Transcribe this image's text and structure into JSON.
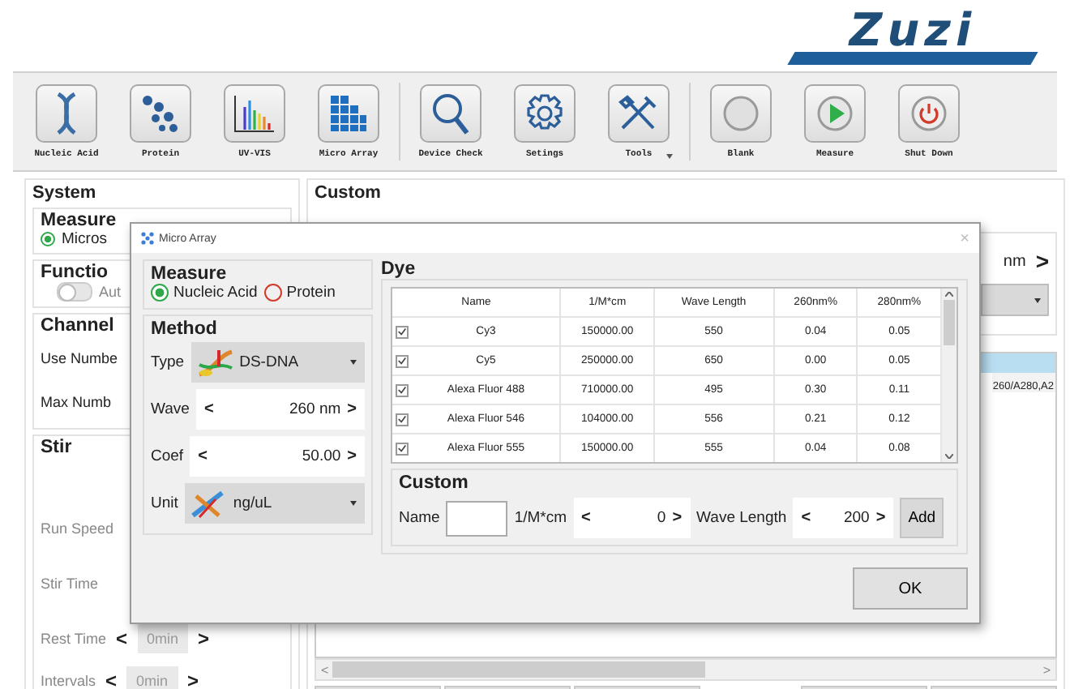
{
  "logo": {
    "text": "Zuzi"
  },
  "toolbar": {
    "groups": [
      {
        "buttons": [
          {
            "label": "Nucleic Acid",
            "menu": false
          },
          {
            "label": "Protein",
            "menu": false
          },
          {
            "label": "UV-VIS",
            "menu": false
          },
          {
            "label": "Micro Array",
            "menu": false
          }
        ]
      },
      {
        "buttons": [
          {
            "label": "Device Check",
            "menu": false
          },
          {
            "label": "Setings",
            "menu": false
          },
          {
            "label": "Tools",
            "menu": true
          }
        ]
      },
      {
        "buttons": [
          {
            "label": "Blank",
            "menu": false
          },
          {
            "label": "Measure",
            "menu": false
          },
          {
            "label": "Shut Down",
            "menu": false
          }
        ]
      }
    ]
  },
  "system": {
    "title": "System",
    "measure": {
      "title": "Measure",
      "option": {
        "label": "Micros",
        "selected": true
      }
    },
    "function": {
      "title": "Functio",
      "toggle": {
        "label": "Aut",
        "on": false
      }
    },
    "channel": {
      "title": "Channel",
      "rows": [
        "Use Numbe",
        "Max Numb"
      ]
    },
    "stir": {
      "title": "Stir",
      "rows": [
        {
          "label": "Run Speed"
        },
        {
          "label": "Stir Time"
        },
        {
          "label": "Rest Time",
          "prev": "<",
          "value": "0min",
          "next": ">"
        },
        {
          "label": "Intervals",
          "prev": "<",
          "value": "0min",
          "next": ">"
        }
      ]
    }
  },
  "custom": {
    "title": "Custom",
    "unit": "nm",
    "next": ">",
    "results": {
      "cell": "260/A280,A2"
    },
    "scroll": {
      "prev": "<",
      "next": ">"
    }
  },
  "dialog": {
    "title": "Micro Array",
    "close": "×",
    "measure": {
      "title": "Measure",
      "options": [
        {
          "label": "Nucleic Acid",
          "selected": true
        },
        {
          "label": "Protein",
          "selected": false
        }
      ]
    },
    "method": {
      "title": "Method",
      "type": {
        "label": "Type",
        "value": "DS-DNA"
      },
      "wave": {
        "label": "Wave",
        "prev": "<",
        "value": "260 nm",
        "next": ">"
      },
      "coef": {
        "label": "Coef",
        "prev": "<",
        "value": "50.00",
        "next": ">"
      },
      "unit": {
        "label": "Unit",
        "value": "ng/uL"
      }
    },
    "dye": {
      "title": "Dye",
      "columns": [
        "Name",
        "1/M*cm",
        "Wave Length",
        "260nm%",
        "280nm%"
      ],
      "rows": [
        {
          "checked": true,
          "cells": [
            "Cy3",
            "150000.00",
            "550",
            "0.04",
            "0.05"
          ]
        },
        {
          "checked": true,
          "cells": [
            "Cy5",
            "250000.00",
            "650",
            "0.00",
            "0.05"
          ]
        },
        {
          "checked": true,
          "cells": [
            "Alexa Fluor 488",
            "710000.00",
            "495",
            "0.30",
            "0.11"
          ]
        },
        {
          "checked": true,
          "cells": [
            "Alexa Fluor 546",
            "104000.00",
            "556",
            "0.21",
            "0.12"
          ]
        },
        {
          "checked": true,
          "cells": [
            "Alexa Fluor 555",
            "150000.00",
            "555",
            "0.04",
            "0.08"
          ]
        }
      ]
    },
    "custom": {
      "title": "Custom",
      "name_label": "Name",
      "coef": {
        "label": "1/M*cm",
        "prev": "<",
        "value": "0",
        "next": ">"
      },
      "wave": {
        "label": "Wave Length",
        "prev": "<",
        "value": "200",
        "next": ">"
      },
      "add": "Add"
    },
    "ok": "OK"
  }
}
